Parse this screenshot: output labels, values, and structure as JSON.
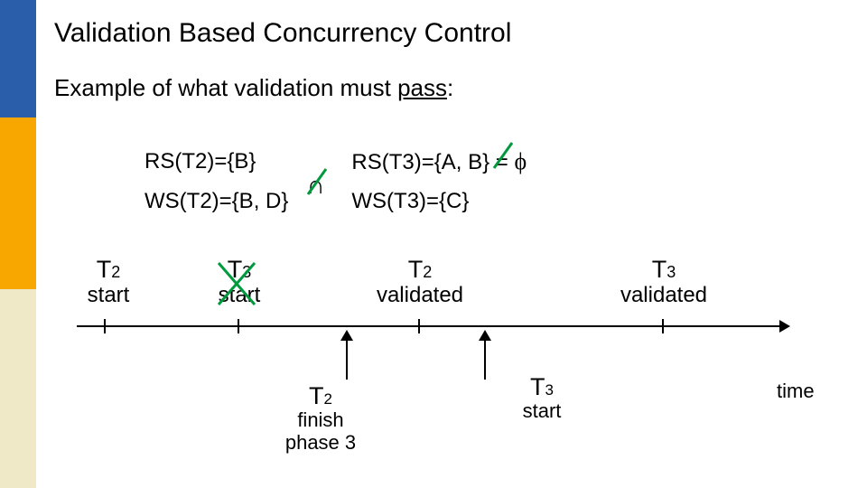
{
  "title": "Validation Based Concurrency Control",
  "subtitle_pre": "Example of what validation must ",
  "subtitle_word": "pass",
  "subtitle_post": ":",
  "sets": {
    "rs_t2": "RS(T2)={B}",
    "ws_t2": "WS(T2)={B, D}",
    "rs_t3": "RS(T3)={A, B}",
    "ws_t3": "WS(T3)={C}",
    "equals": "=",
    "phi": "ϕ",
    "intersect_glyph": "∩"
  },
  "timeline": {
    "t2_start": {
      "top": "T2",
      "bot": "start"
    },
    "t3_start_crossed": {
      "top": "T3",
      "bot": "start"
    },
    "t2_validated": {
      "top": "T2",
      "bot": "validated"
    },
    "t3_validated": {
      "top": "T3",
      "bot": "validated"
    },
    "t2_finish": {
      "l1": "T2",
      "l2": "finish",
      "l3": "phase 3"
    },
    "t3_start_below": {
      "top": "T3",
      "bot": "start"
    },
    "time_label": "time"
  },
  "colors": {
    "blue": "#2b5eaa",
    "gold": "#f7a700",
    "cream": "#efe9c8",
    "green": "#009a3e"
  }
}
